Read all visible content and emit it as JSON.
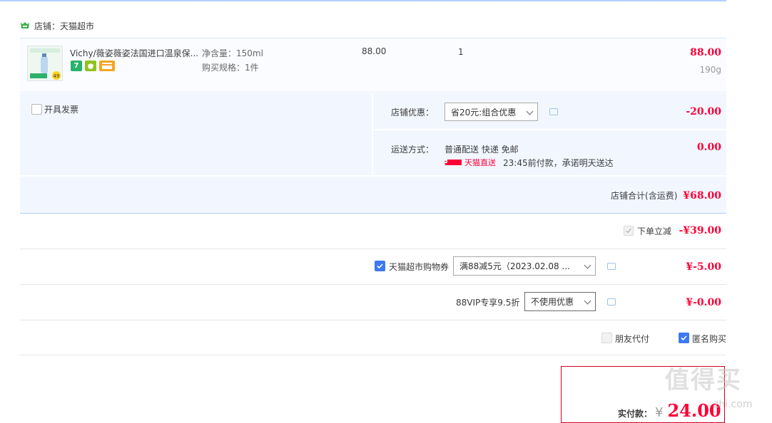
{
  "shop": {
    "name_label": "店铺：天猫超市"
  },
  "item": {
    "title": "Vichy/薇姿薇姿法国进口温泉保...",
    "spec1": "净含量：150ml",
    "spec2": "购买规格：1件",
    "unit_price": "88.00",
    "quantity": "1",
    "subtotal": "88.00",
    "weight": "190g",
    "badges": [
      "7",
      "",
      ""
    ],
    "thumb_tag": "49"
  },
  "invoice": {
    "label": "开具发票"
  },
  "shop_discount": {
    "label": "店铺优惠：",
    "selected": "省20元:组合优惠",
    "amount": "-20.00"
  },
  "shipping": {
    "label": "运送方式：",
    "method": "普通配送 快递 免邮",
    "badge": "天猫直送",
    "promise": "23:45前付款，承诺明天送达",
    "amount": "0.00"
  },
  "shop_total": {
    "label": "店铺合计(含运费)",
    "amount": "¥68.00"
  },
  "instant_discount": {
    "label": "下单立减",
    "amount": "-¥39.00"
  },
  "coupon": {
    "label": "天猫超市购物券",
    "selected": "满88减5元（2023.02.08 ...",
    "amount": "¥-5.00"
  },
  "vip": {
    "label": "88VIP专享9.5折",
    "selected": "不使用优惠",
    "amount": "¥-0.00"
  },
  "options": {
    "friend_pay": "朋友代付",
    "anonymous": "匿名购买"
  },
  "payment": {
    "label": "实付款：",
    "currency": "¥",
    "amount": "24.00"
  },
  "watermark": {
    "text": "值得买",
    "url": "zhi.com"
  },
  "colors": {
    "accent_red": "#ff0036",
    "blue_panel": "#f2f7ff",
    "checkbox_blue": "#3d7af2"
  }
}
